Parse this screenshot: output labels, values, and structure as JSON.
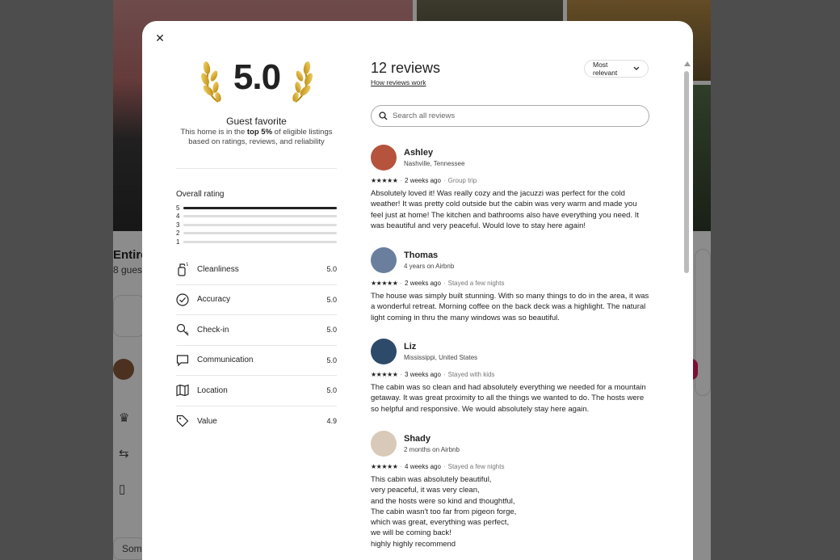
{
  "background": {
    "title_fragment": "Entire",
    "subtitle_fragment": "8 guest",
    "bottom_fragment": "Some"
  },
  "modal": {
    "close_icon": "close-icon",
    "score": "5.0",
    "guest_favorite": {
      "title": "Guest favorite",
      "desc_prefix": "This home is in the ",
      "desc_bold": "top 5%",
      "desc_suffix": " of eligible listings based on ratings, reviews, and reliability"
    },
    "overall_rating": {
      "label": "Overall rating",
      "bars": [
        {
          "stars": "5",
          "fraction": 1.0
        },
        {
          "stars": "4",
          "fraction": 0.0
        },
        {
          "stars": "3",
          "fraction": 0.0
        },
        {
          "stars": "2",
          "fraction": 0.0
        },
        {
          "stars": "1",
          "fraction": 0.0
        }
      ]
    },
    "categories": [
      {
        "label": "Cleanliness",
        "value": "5.0",
        "icon": "spray-bottle-icon"
      },
      {
        "label": "Accuracy",
        "value": "5.0",
        "icon": "check-circle-icon"
      },
      {
        "label": "Check-in",
        "value": "5.0",
        "icon": "key-icon"
      },
      {
        "label": "Communication",
        "value": "5.0",
        "icon": "chat-bubble-icon"
      },
      {
        "label": "Location",
        "value": "5.0",
        "icon": "map-icon"
      },
      {
        "label": "Value",
        "value": "4.9",
        "icon": "tag-icon"
      }
    ],
    "reviews_header": {
      "title": "12 reviews",
      "how_link": "How reviews work",
      "sort_label": "Most relevant",
      "search_placeholder": "Search all reviews"
    },
    "reviews": [
      {
        "name": "Ashley",
        "location": "Nashville, Tennessee",
        "stars": "★★★★★",
        "time": "2 weeks ago",
        "trip": "Group trip",
        "text": "Absolutely loved it! Was really cozy and the jacuzzi was perfect for the cold weather! It was pretty cold outside but the cabin was very warm and made you feel just at home! The kitchen and bathrooms also have everything you need. It was beautiful and very peaceful. Would love to stay here again!",
        "avatar_color": "#b5533c"
      },
      {
        "name": "Thomas",
        "location": "4 years on Airbnb",
        "stars": "★★★★★",
        "time": "2 weeks ago",
        "trip": "Stayed a few nights",
        "text": "The house was simply built stunning.  With so many things to do in the area, it was a wonderful retreat.  Morning coffee on the back deck was a highlight.  The natural light coming in thru the many windows was so beautiful.",
        "avatar_color": "#6a7f9e"
      },
      {
        "name": "Liz",
        "location": "Mississippi, United States",
        "stars": "★★★★★",
        "time": "3 weeks ago",
        "trip": "Stayed with kids",
        "text": "The cabin was so clean and had absolutely everything we needed for a mountain getaway. It was great proximity to all the things we wanted to do. The hosts were so helpful and responsive. We would absolutely stay here again.",
        "avatar_color": "#2d4a6b"
      },
      {
        "name": "Shady",
        "location": "2 months on Airbnb",
        "stars": "★★★★★",
        "time": "4 weeks ago",
        "trip": "Stayed a few nights",
        "text": "This cabin was absolutely beautiful,\nvery peaceful, it was very clean,\nand the hosts were so kind and thoughtful,\nThe cabin wasn't too far from pigeon forge,\nwhich was great, everything was perfect,\nwe will be coming back!\nhighly highly recommend",
        "avatar_color": "#d9c9b8"
      }
    ]
  }
}
